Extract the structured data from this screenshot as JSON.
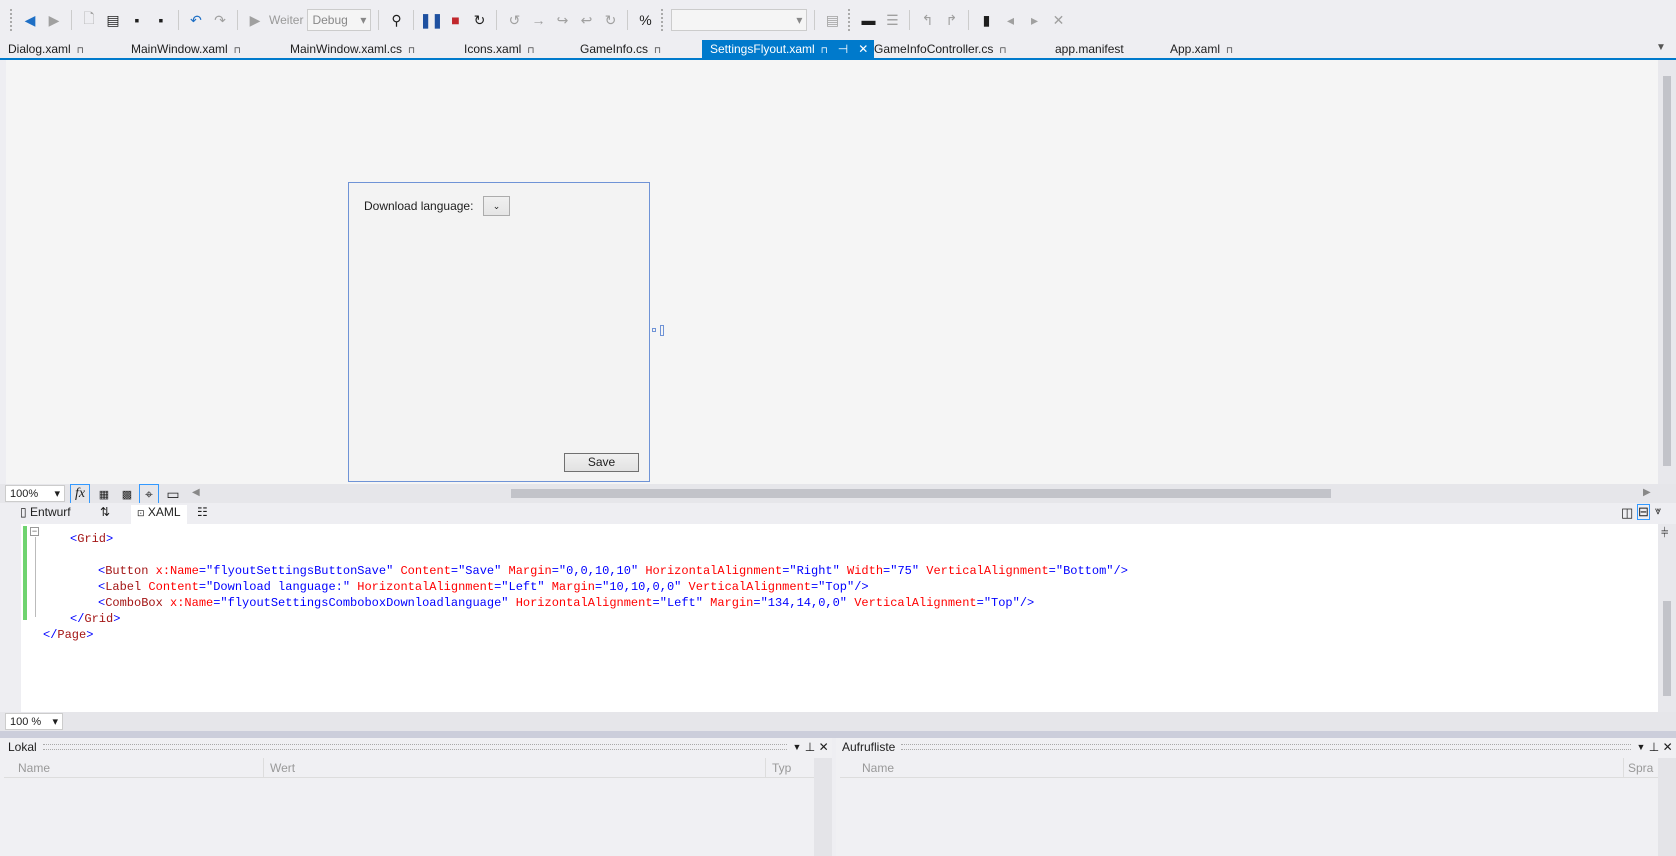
{
  "toolbar": {
    "continue_label": "Weiter",
    "config_value": "Debug",
    "platform_value": "",
    "icons": [
      "back-icon",
      "forward-icon",
      "new-item-icon",
      "open-icon",
      "save-icon",
      "save-all-icon",
      "undo-icon",
      "redo-icon",
      "continue-icon",
      "find-icon",
      "pause-icon",
      "stop-icon",
      "restart-icon",
      "show-next-statement-icon",
      "step-into-icon",
      "step-over-icon",
      "step-out-icon",
      "hex-icon",
      "bookmark-icon"
    ]
  },
  "tabs": [
    {
      "label": "Dialog.xaml",
      "locked": true
    },
    {
      "label": "MainWindow.xaml",
      "locked": true
    },
    {
      "label": "MainWindow.xaml.cs",
      "locked": true
    },
    {
      "label": "Icons.xaml",
      "locked": true
    },
    {
      "label": "GameInfo.cs",
      "locked": true
    },
    {
      "label": "SettingsFlyout.xaml",
      "locked": true,
      "active": true
    },
    {
      "label": "GameInfoController.cs",
      "locked": true
    },
    {
      "label": "app.manifest",
      "locked": false
    },
    {
      "label": "App.xaml",
      "locked": true
    }
  ],
  "designer": {
    "label_text": "Download language:",
    "save_button": "Save",
    "zoom": "100%"
  },
  "view_tabs": {
    "design": "Entwurf",
    "swap": "⇅",
    "xaml": "XAML"
  },
  "code_lines": [
    [
      {
        "t": "pun",
        "v": "<"
      },
      {
        "t": "tag",
        "v": "Grid"
      },
      {
        "t": "pun",
        "v": ">"
      }
    ],
    [],
    [
      {
        "t": "pun",
        "v": "<"
      },
      {
        "t": "tag",
        "v": "Button"
      },
      {
        "t": "attr",
        "v": " x:Name"
      },
      {
        "t": "pun",
        "v": "=\""
      },
      {
        "t": "val",
        "v": "flyoutSettingsButtonSave"
      },
      {
        "t": "pun",
        "v": "\""
      },
      {
        "t": "attr",
        "v": " Content"
      },
      {
        "t": "pun",
        "v": "=\""
      },
      {
        "t": "val",
        "v": "Save"
      },
      {
        "t": "pun",
        "v": "\""
      },
      {
        "t": "attr",
        "v": " Margin"
      },
      {
        "t": "pun",
        "v": "=\""
      },
      {
        "t": "val",
        "v": "0,0,10,10"
      },
      {
        "t": "pun",
        "v": "\""
      },
      {
        "t": "attr",
        "v": " HorizontalAlignment"
      },
      {
        "t": "pun",
        "v": "=\""
      },
      {
        "t": "val",
        "v": "Right"
      },
      {
        "t": "pun",
        "v": "\""
      },
      {
        "t": "attr",
        "v": " Width"
      },
      {
        "t": "pun",
        "v": "=\""
      },
      {
        "t": "val",
        "v": "75"
      },
      {
        "t": "pun",
        "v": "\""
      },
      {
        "t": "attr",
        "v": " VerticalAlignment"
      },
      {
        "t": "pun",
        "v": "=\""
      },
      {
        "t": "val",
        "v": "Bottom"
      },
      {
        "t": "pun",
        "v": "\"/>"
      }
    ],
    [
      {
        "t": "pun",
        "v": "<"
      },
      {
        "t": "tag",
        "v": "Label"
      },
      {
        "t": "attr",
        "v": " Content"
      },
      {
        "t": "pun",
        "v": "=\""
      },
      {
        "t": "val",
        "v": "Download language:"
      },
      {
        "t": "pun",
        "v": "\""
      },
      {
        "t": "attr",
        "v": " HorizontalAlignment"
      },
      {
        "t": "pun",
        "v": "=\""
      },
      {
        "t": "val",
        "v": "Left"
      },
      {
        "t": "pun",
        "v": "\""
      },
      {
        "t": "attr",
        "v": " Margin"
      },
      {
        "t": "pun",
        "v": "=\""
      },
      {
        "t": "val",
        "v": "10,10,0,0"
      },
      {
        "t": "pun",
        "v": "\""
      },
      {
        "t": "attr",
        "v": " VerticalAlignment"
      },
      {
        "t": "pun",
        "v": "=\""
      },
      {
        "t": "val",
        "v": "Top"
      },
      {
        "t": "pun",
        "v": "\"/>"
      }
    ],
    [
      {
        "t": "pun",
        "v": "<"
      },
      {
        "t": "tag",
        "v": "ComboBox"
      },
      {
        "t": "attr",
        "v": " x:Name"
      },
      {
        "t": "pun",
        "v": "=\""
      },
      {
        "t": "val",
        "v": "flyoutSettingsComboboxDownloadlanguage"
      },
      {
        "t": "pun",
        "v": "\""
      },
      {
        "t": "attr",
        "v": " HorizontalAlignment"
      },
      {
        "t": "pun",
        "v": "=\""
      },
      {
        "t": "val",
        "v": "Left"
      },
      {
        "t": "pun",
        "v": "\""
      },
      {
        "t": "attr",
        "v": " Margin"
      },
      {
        "t": "pun",
        "v": "=\""
      },
      {
        "t": "val",
        "v": "134,14,0,0"
      },
      {
        "t": "pun",
        "v": "\""
      },
      {
        "t": "attr",
        "v": " VerticalAlignment"
      },
      {
        "t": "pun",
        "v": "=\""
      },
      {
        "t": "val",
        "v": "Top"
      },
      {
        "t": "pun",
        "v": "\"/>"
      }
    ],
    [
      {
        "t": "pun",
        "v": "</"
      },
      {
        "t": "tag",
        "v": "Grid"
      },
      {
        "t": "pun",
        "v": ">"
      }
    ],
    [
      {
        "t": "pun",
        "v": "</"
      },
      {
        "t": "tag",
        "v": "Page"
      },
      {
        "t": "pun",
        "v": ">"
      }
    ]
  ],
  "editor": {
    "zoom": "100 %"
  },
  "locals_panel": {
    "title": "Lokal",
    "columns": [
      "Name",
      "Wert",
      "Typ"
    ]
  },
  "callstack_panel": {
    "title": "Aufrufliste",
    "columns": [
      "Name",
      "Spra"
    ]
  },
  "colors": {
    "accent": "#007acc",
    "xml_tag": "#a31515",
    "xml_attr": "#ff0000",
    "xml_value": "#0000ff",
    "change_bar": "#6fd36f"
  }
}
